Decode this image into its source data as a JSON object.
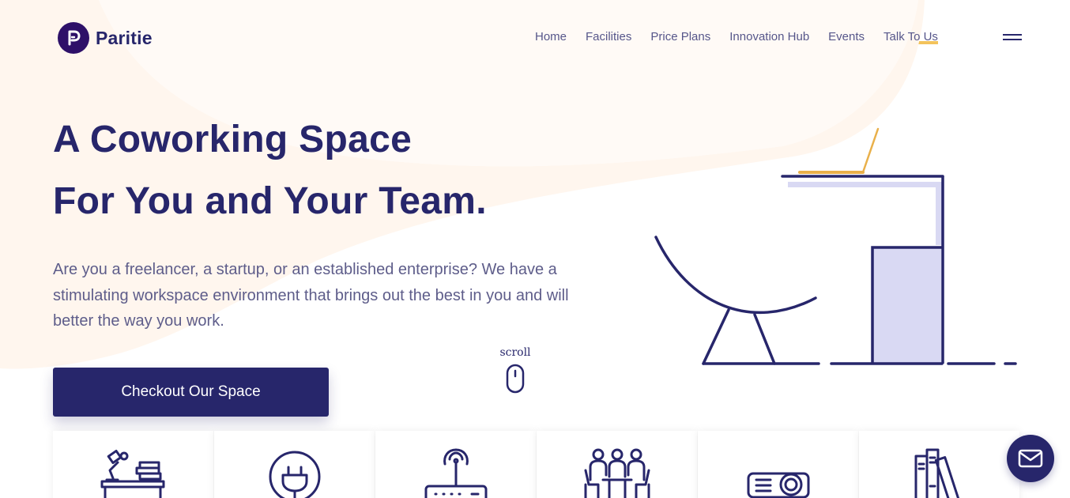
{
  "brand": {
    "name": "Paritie",
    "logo_icon": "p-logo-icon",
    "colors": {
      "primary": "#27266b",
      "accent": "#f3c35b",
      "background_blob": "#fff6ee",
      "illustration_fill": "#d9d9f3"
    }
  },
  "nav": {
    "items": [
      {
        "label": "Home",
        "active": false
      },
      {
        "label": "Facilities",
        "active": false
      },
      {
        "label": "Price Plans",
        "active": false
      },
      {
        "label": "Innovation Hub",
        "active": false
      },
      {
        "label": "Events",
        "active": false
      },
      {
        "label": "Talk To Us",
        "active": true
      }
    ],
    "menu_icon": "hamburger-menu-icon"
  },
  "hero": {
    "title_line1": "A Coworking Space",
    "title_line2": "For You and Your Team.",
    "description": "Are you a freelancer, a startup, or an established enterprise? We have a stimulating workspace environment that brings out the best in you and will better the way you work.",
    "cta_label": "Checkout Our Space",
    "scroll_label": "scroll",
    "scroll_icon": "mouse-scroll-icon",
    "illustration": "desk-and-chair-illustration"
  },
  "facilities": [
    {
      "icon": "desk-lamp-icon"
    },
    {
      "icon": "power-plug-icon"
    },
    {
      "icon": "wifi-router-icon"
    },
    {
      "icon": "meeting-people-icon"
    },
    {
      "icon": "projector-icon"
    },
    {
      "icon": "books-icon"
    }
  ],
  "chat": {
    "icon": "mail-icon"
  }
}
